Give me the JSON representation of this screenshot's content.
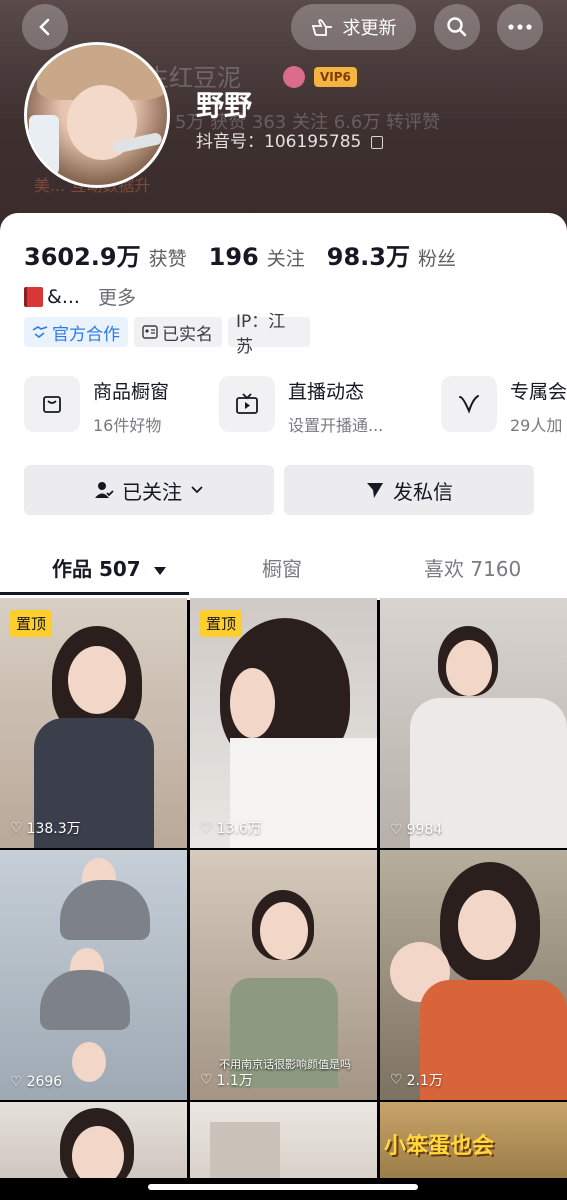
{
  "header": {
    "ghost_name": "生红豆泥",
    "ghost_stats": "5万 获赞   363 关注   6.6万 转评赞",
    "ghost_hint": "美... 互动数据升",
    "vip_badge": "VIP6",
    "display_name": "野野",
    "douyin_id": "抖音号：106195785",
    "request_update_label": "求更新"
  },
  "stats": {
    "likes_num": "3602.9万",
    "likes_label": "获赞",
    "following_num": "196",
    "following_label": "关注",
    "followers_num": "98.3万",
    "followers_label": "粉丝"
  },
  "bio": {
    "text": "&...",
    "more": "更多"
  },
  "tags": {
    "official": "官方合作",
    "verified": "已实名",
    "ip": "IP：江苏"
  },
  "tiles": [
    {
      "title": "商品橱窗",
      "subtitle": "16件好物"
    },
    {
      "title": "直播动态",
      "subtitle": "设置开播通..."
    },
    {
      "title": "专属会",
      "subtitle": "29人加"
    }
  ],
  "actions": {
    "follow": "已关注",
    "message": "发私信"
  },
  "tabs": {
    "works": "作品 507",
    "showcase": "橱窗",
    "liked": "喜欢 7160"
  },
  "videos": [
    {
      "pinned": "置顶",
      "likes": "138.3万"
    },
    {
      "pinned": "置顶",
      "likes": "13.6万"
    },
    {
      "pinned": "",
      "likes": "9984"
    },
    {
      "pinned": "",
      "likes": "2696"
    },
    {
      "pinned": "",
      "likes": "1.1万",
      "caption": "不用南京话很影响颜值是吗"
    },
    {
      "pinned": "",
      "likes": "2.1万"
    },
    {
      "pinned": "",
      "likes": ""
    },
    {
      "pinned": "",
      "likes": ""
    },
    {
      "pinned": "",
      "likes": "",
      "caption": "小笨蛋也会"
    }
  ],
  "colors": {
    "pin_bg": "#fece2c",
    "official_tag": "#2c7be5",
    "vip": "#f5b341"
  }
}
